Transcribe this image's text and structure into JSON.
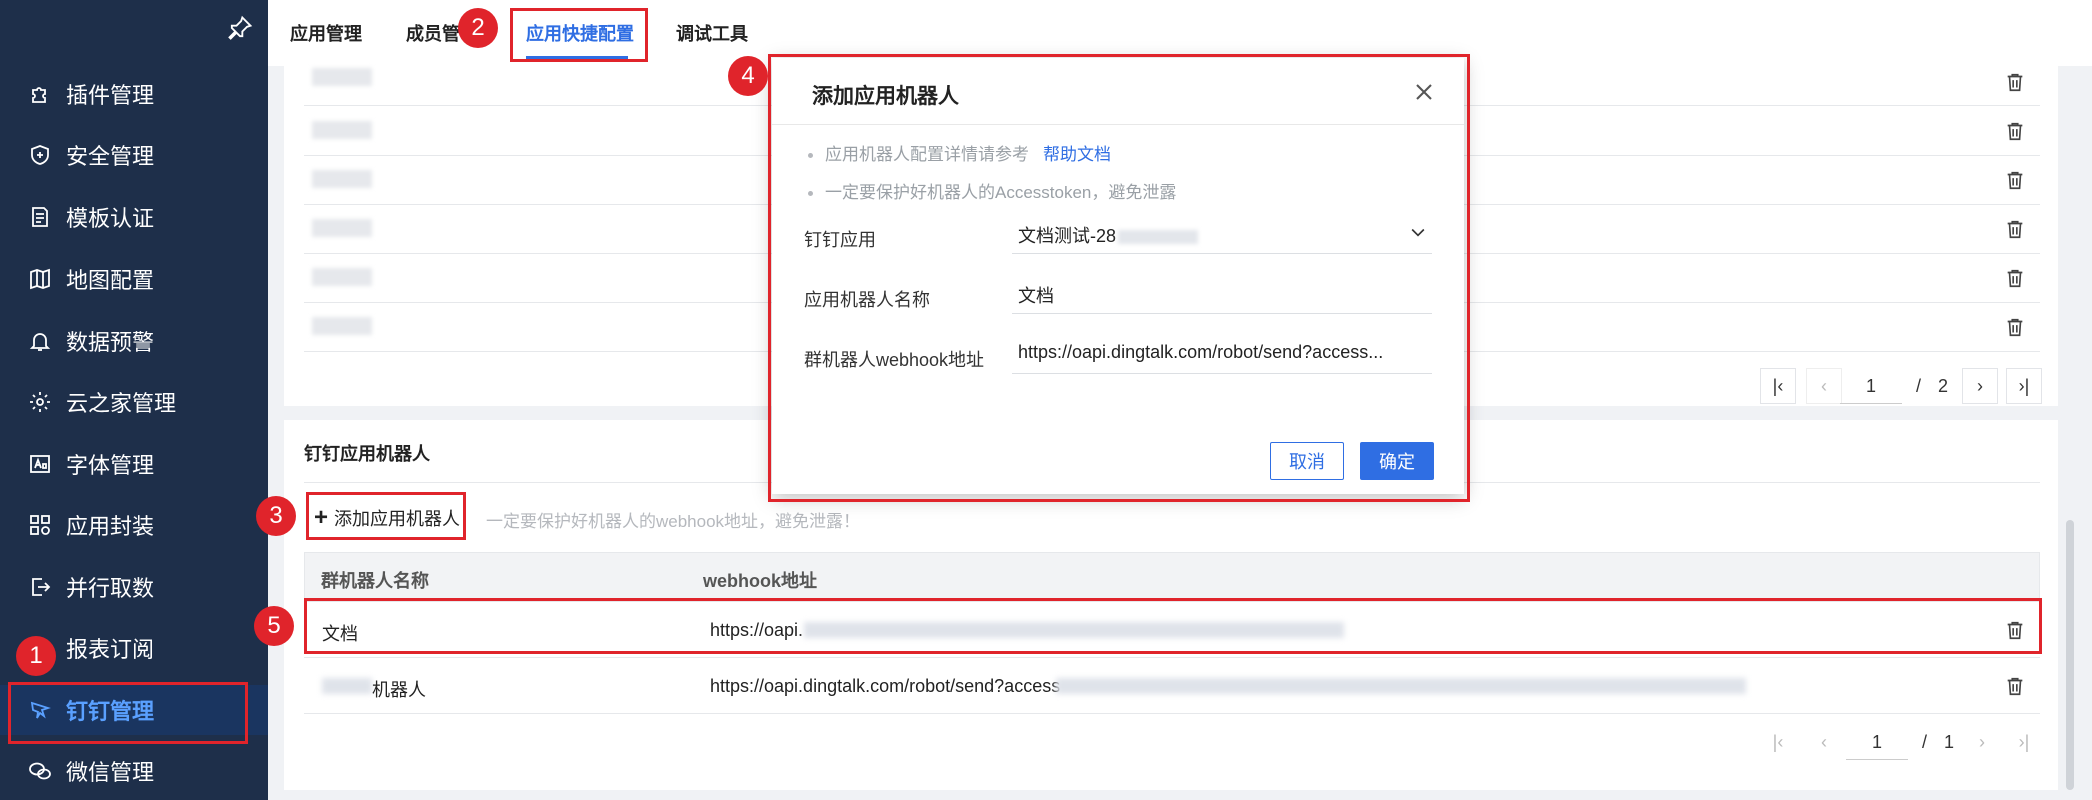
{
  "sidebar": {
    "items": [
      {
        "label": "插件管理",
        "icon": "puzzle-icon"
      },
      {
        "label": "安全管理",
        "icon": "shield-icon"
      },
      {
        "label": "模板认证",
        "icon": "template-icon"
      },
      {
        "label": "地图配置",
        "icon": "map-icon"
      },
      {
        "label": "数据预警",
        "icon": "bell-icon"
      },
      {
        "label": "云之家管理",
        "icon": "gear-icon"
      },
      {
        "label": "字体管理",
        "icon": "font-icon"
      },
      {
        "label": "应用封装",
        "icon": "grid-icon"
      },
      {
        "label": "并行取数",
        "icon": "exit-icon"
      },
      {
        "label": "报表订阅",
        "icon": "subscribe-icon"
      },
      {
        "label": "钉钉管理",
        "icon": "dingtalk-icon",
        "active": true
      },
      {
        "label": "微信管理",
        "icon": "wechat-icon"
      }
    ]
  },
  "tabs": [
    {
      "label": "应用管理"
    },
    {
      "label": "成员管"
    },
    {
      "label": "应用快捷配置",
      "active": true
    },
    {
      "label": "调试工具"
    }
  ],
  "upper_pager": {
    "current": "1",
    "separator": "/",
    "total": "2"
  },
  "robot_section": {
    "title": "钉钉应用机器人",
    "add_label": "添加应用机器人",
    "hint": "一定要保护好机器人的webhook地址，避免泄露！",
    "columns": [
      "群机器人名称",
      "webhook地址"
    ],
    "rows": [
      {
        "name": "文档",
        "webhook": "https://oapi."
      },
      {
        "name": "机器人",
        "webhook": "https://oapi.dingtalk.com/robot/send?access"
      }
    ]
  },
  "lower_pager": {
    "current": "1",
    "separator": "/",
    "total": "1"
  },
  "modal": {
    "title": "添加应用机器人",
    "tip1": "应用机器人配置详情请参考",
    "tip1_link": "帮助文档",
    "tip2": "一定要保护好机器人的Accesstoken，避免泄露",
    "fields": [
      {
        "label": "钉钉应用",
        "value": "文档测试-28"
      },
      {
        "label": "应用机器人名称",
        "value": "文档"
      },
      {
        "label": "群机器人webhook地址",
        "value": "https://oapi.dingtalk.com/robot/send?access..."
      }
    ],
    "cancel": "取消",
    "ok": "确定"
  },
  "annotations": [
    "1",
    "2",
    "3",
    "4",
    "5"
  ],
  "colors": {
    "accent": "#2f6ee3",
    "sidebar": "#1e2f4a",
    "annotation": "#e0242b"
  }
}
